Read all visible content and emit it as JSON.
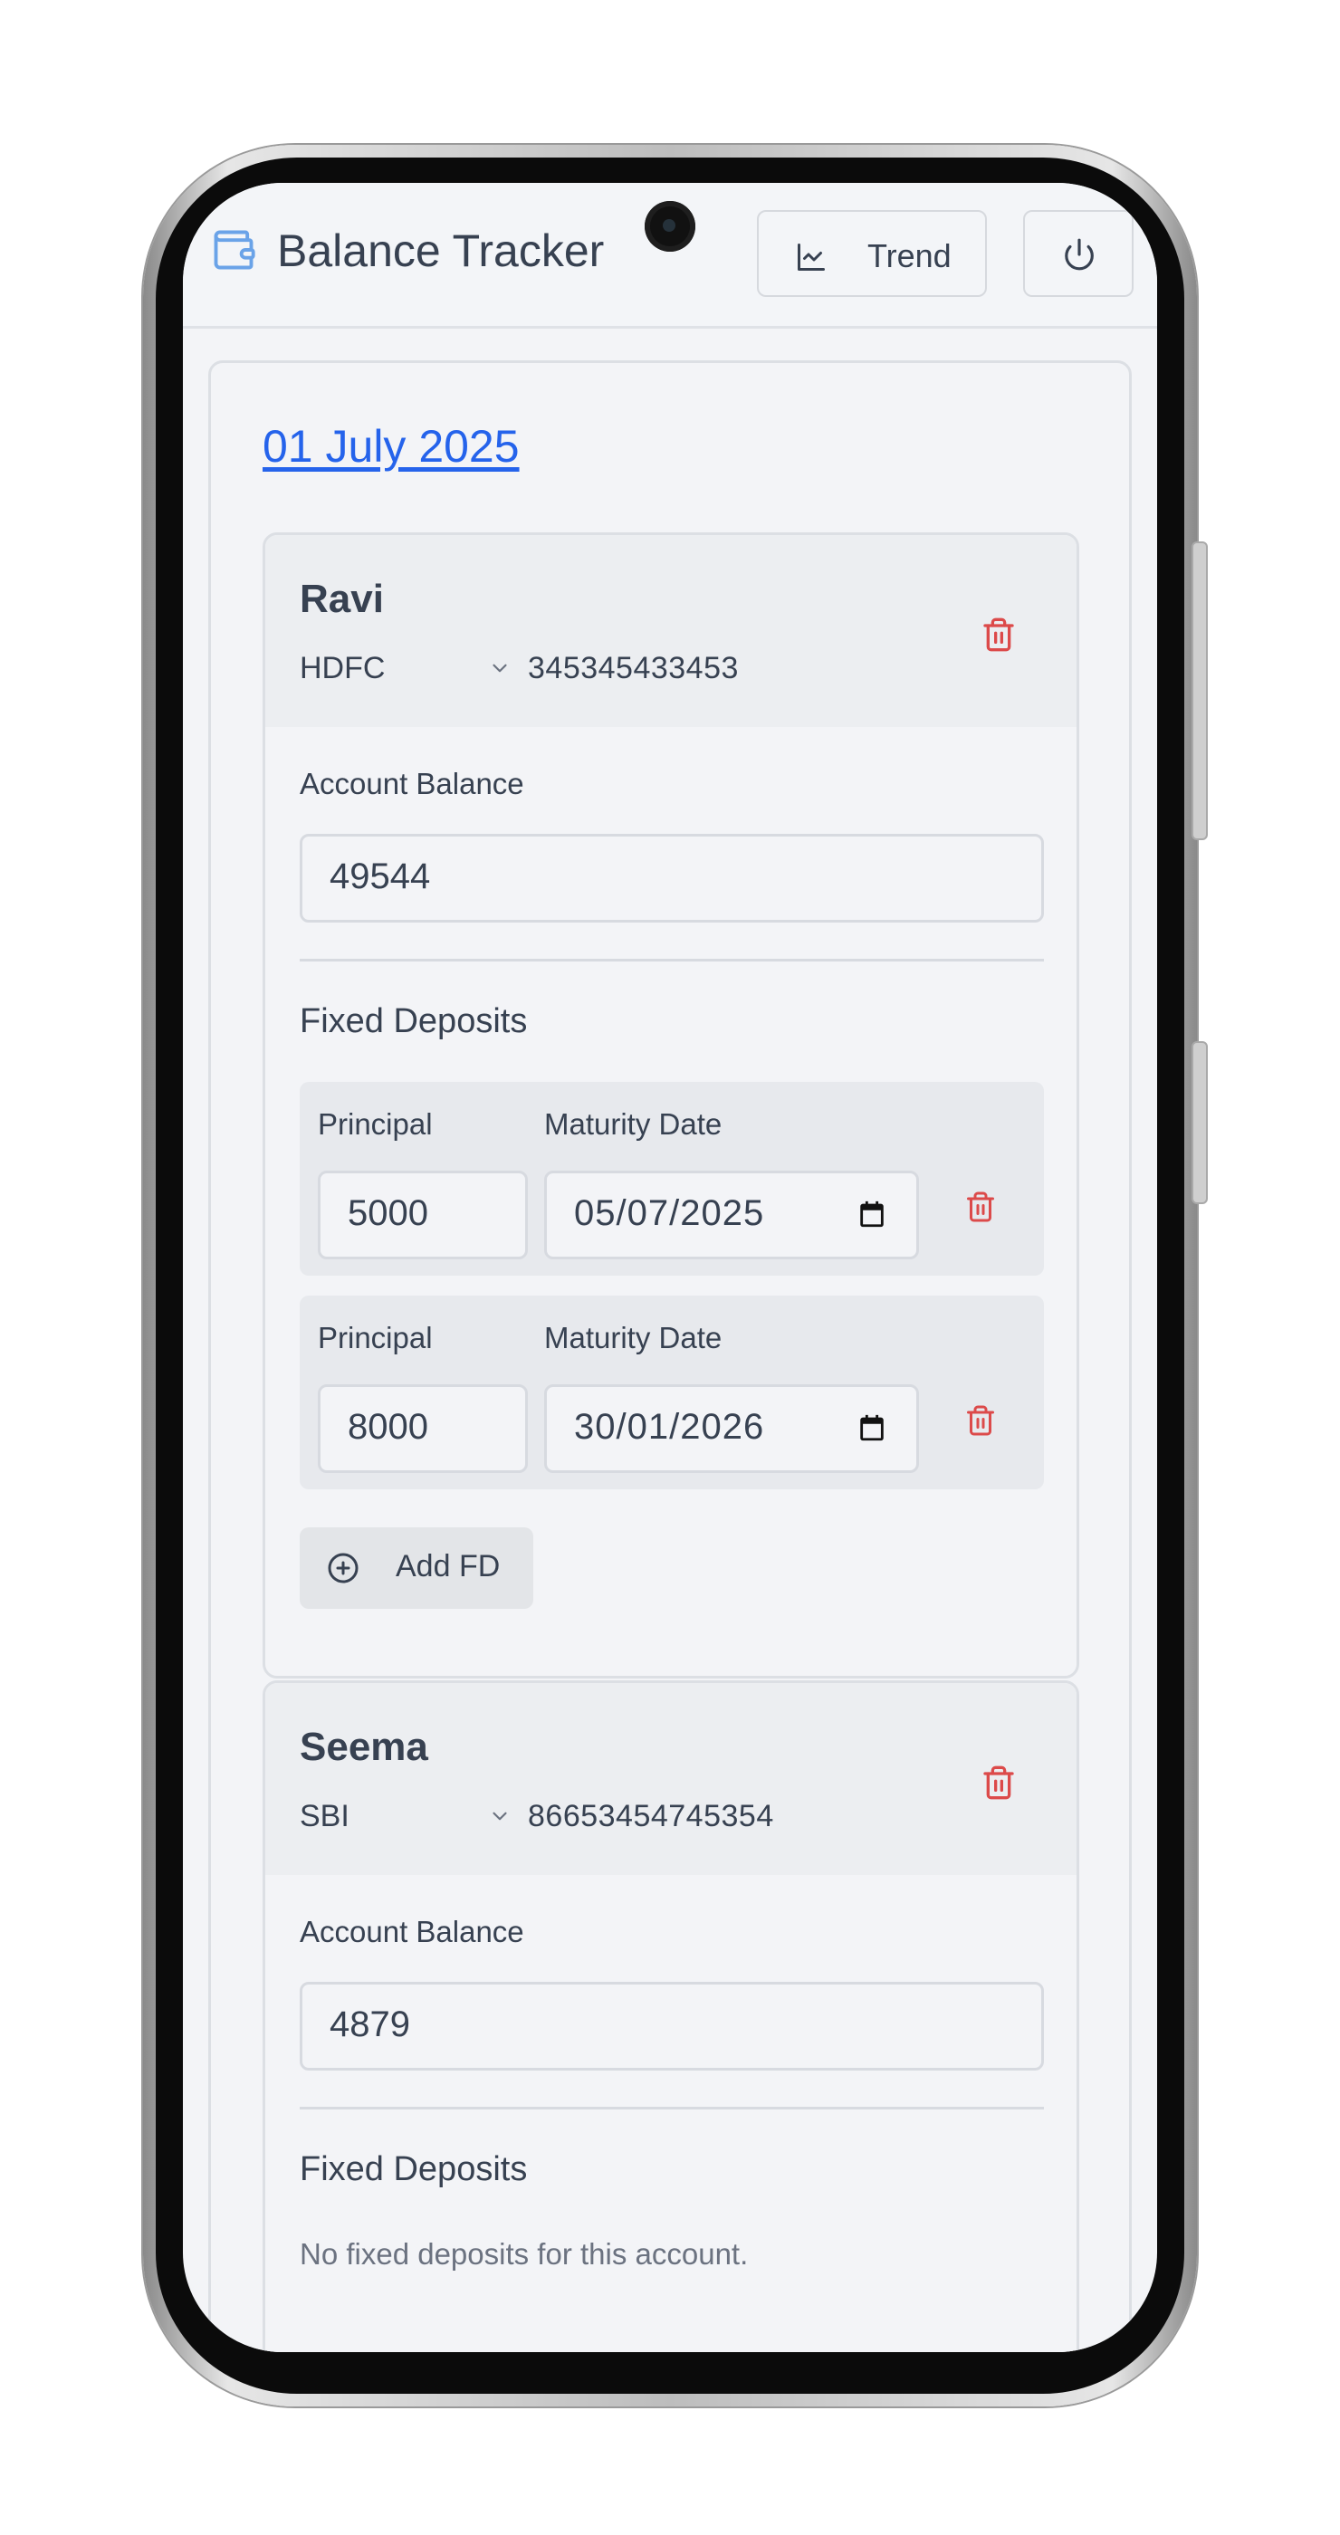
{
  "header": {
    "title": "Balance Tracker",
    "trend_label": "Trend",
    "icons": {
      "logo": "wallet-icon",
      "trend": "line-chart-icon",
      "power": "power-icon"
    }
  },
  "date_label": "01 July 2025",
  "accounts": [
    {
      "name": "Ravi",
      "bank": "HDFC",
      "number": "345345433453",
      "balance_label": "Account Balance",
      "balance": "49544",
      "fd_title": "Fixed Deposits",
      "fds": [
        {
          "principal_label": "Principal",
          "principal": "5000",
          "maturity_label": "Maturity Date",
          "maturity": "05/07/2025"
        },
        {
          "principal_label": "Principal",
          "principal": "8000",
          "maturity_label": "Maturity Date",
          "maturity": "30/01/2026"
        }
      ],
      "add_fd_label": "Add FD"
    },
    {
      "name": "Seema",
      "bank": "SBI",
      "number": "86653454745354",
      "balance_label": "Account Balance",
      "balance": "4879",
      "fd_title": "Fixed Deposits",
      "empty_message": "No fixed deposits for this account."
    }
  ],
  "colors": {
    "accent": "#2563eb",
    "danger": "#dc4a4a",
    "background": "#f3f4f7",
    "text": "#374151"
  }
}
